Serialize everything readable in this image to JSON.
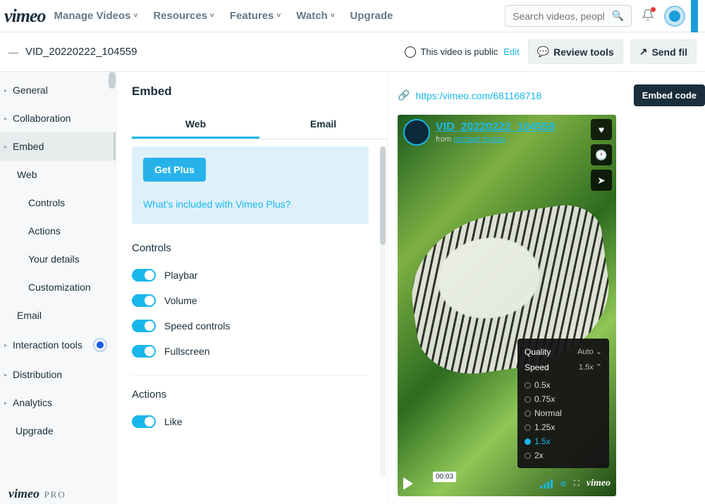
{
  "nav": {
    "logo": "vimeo",
    "items": [
      "Manage Videos",
      "Resources",
      "Features",
      "Watch",
      "Upgrade"
    ],
    "search_placeholder": "Search videos, peopl"
  },
  "bar": {
    "video_name": "VID_20220222_104559",
    "privacy_text": "This video is public",
    "edit": "Edit",
    "review_btn": "Review tools",
    "send_btn": "Send fil"
  },
  "sidebar": {
    "general": "General",
    "collaboration": "Collaboration",
    "embed": "Embed",
    "web": "Web",
    "controls": "Controls",
    "actions": "Actions",
    "your_details": "Your details",
    "customization": "Customization",
    "email": "Email",
    "interaction": "Interaction tools",
    "distribution": "Distribution",
    "analytics": "Analytics",
    "upgrade": "Upgrade",
    "pro_logo": "vimeo",
    "pro_label": "PRO"
  },
  "center": {
    "heading": "Embed",
    "tab_web": "Web",
    "tab_email": "Email",
    "get_plus": "Get Plus",
    "whats_included": "What's included with Vimeo Plus?",
    "controls_h": "Controls",
    "playbar": "Playbar",
    "volume": "Volume",
    "speed": "Speed controls",
    "fullscreen": "Fullscreen",
    "actions_h": "Actions",
    "like": "Like"
  },
  "right": {
    "url": "https:/vimeo.com/681168718",
    "embed_btn": "Embed code",
    "player_title": "VID_20220222_104559",
    "from_label": "from ",
    "author": "michael musau",
    "quality_label": "Quality",
    "quality_value": "Auto",
    "speed_label": "Speed",
    "speed_value": "1.5x",
    "speeds": [
      "0.5x",
      "0.75x",
      "Normal",
      "1.25x",
      "1.5x",
      "2x"
    ],
    "selected_speed": "1.5x",
    "time": "00:03",
    "vimeo_logo": "vimeo"
  }
}
